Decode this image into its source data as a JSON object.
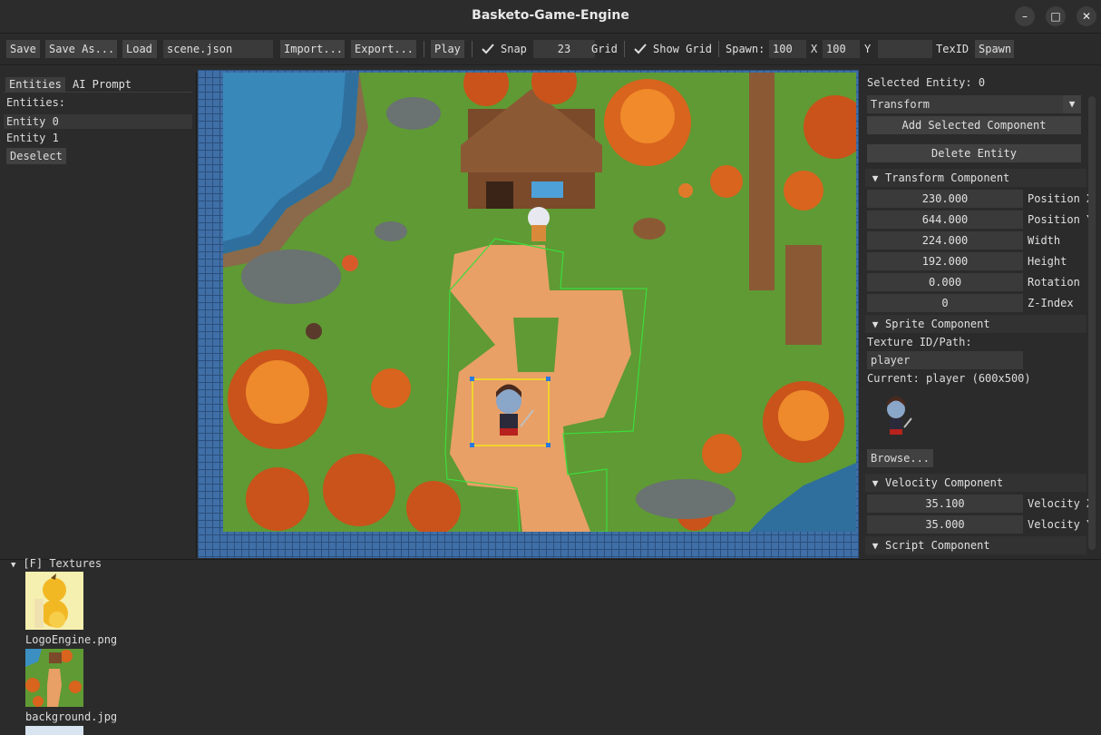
{
  "window": {
    "title": "Basketo-Game-Engine",
    "minimize_glyph": "–",
    "maximize_glyph": "□",
    "close_glyph": "✕"
  },
  "toolbar": {
    "save": "Save",
    "save_as": "Save As...",
    "load": "Load",
    "scene_file": "scene.json",
    "import": "Import...",
    "export": "Export...",
    "play": "Play",
    "snap_label": "Snap",
    "snap_checked": true,
    "grid_size": "23",
    "grid_label": "Grid",
    "show_grid_label": "Show Grid",
    "show_grid_checked": true,
    "spawn_label": "Spawn:",
    "spawn_x": "100",
    "x_label": "X",
    "spawn_y": "100",
    "y_label": "Y",
    "texid_value": "",
    "texid_label": "TexID",
    "spawn_button": "Spawn"
  },
  "left_panel": {
    "tabs": [
      "Entities",
      "AI Prompt"
    ],
    "heading": "Entities:",
    "entities": [
      "Entity 0",
      "Entity 1"
    ],
    "deselect": "Deselect"
  },
  "inspector": {
    "selected_entity": "Selected Entity: 0",
    "component_dropdown": "Transform",
    "add_component": "Add Selected Component",
    "delete_entity": "Delete Entity",
    "transform": {
      "header": "Transform Component",
      "fields": [
        {
          "value": "230.000",
          "label": "Position X"
        },
        {
          "value": "644.000",
          "label": "Position Y"
        },
        {
          "value": "224.000",
          "label": "Width"
        },
        {
          "value": "192.000",
          "label": "Height"
        },
        {
          "value": "0.000",
          "label": "Rotation"
        },
        {
          "value": "0",
          "label": "Z-Index"
        }
      ]
    },
    "sprite": {
      "header": "Sprite Component",
      "texture_label": "Texture ID/Path:",
      "texture_value": "player",
      "current": "Current: player (600x500)",
      "browse": "Browse..."
    },
    "velocity": {
      "header": "Velocity Component",
      "fields": [
        {
          "value": "35.100",
          "label": "Velocity X"
        },
        {
          "value": "35.000",
          "label": "Velocity Y"
        }
      ]
    },
    "script": {
      "header": "Script Component"
    }
  },
  "assets": {
    "folder": "[F] Textures",
    "files": [
      "LogoEngine.png",
      "background.jpg"
    ]
  },
  "colors": {
    "selection_yellow": "#f2e21c",
    "collider_green": "#3ddc3d",
    "grid_blue": "#3f6fa6"
  }
}
